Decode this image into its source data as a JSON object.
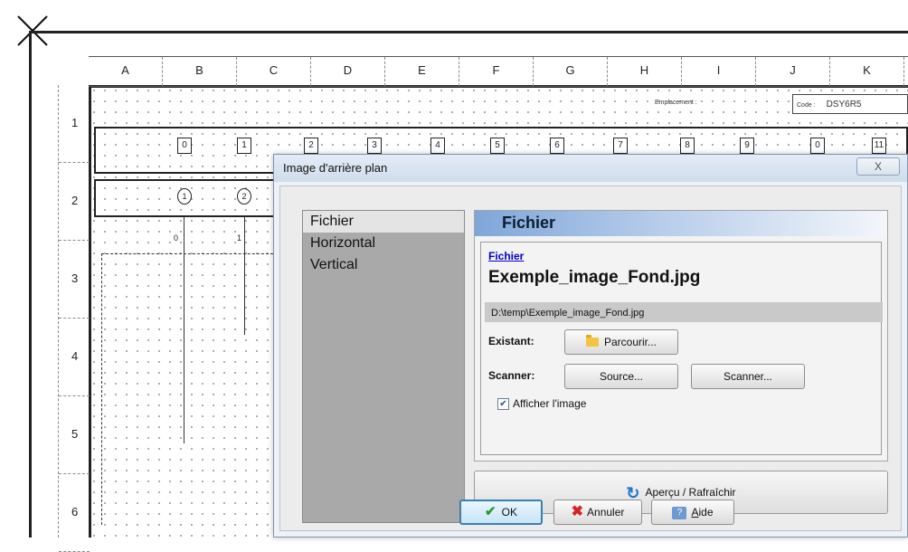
{
  "drawing": {
    "columns": [
      "A",
      "B",
      "C",
      "D",
      "E",
      "F",
      "G",
      "H",
      "I",
      "J",
      "K"
    ],
    "rows": [
      "1",
      "2",
      "3",
      "4",
      "5",
      "6"
    ],
    "header_fields": {
      "emplacement_label": "Emplacement :",
      "code_label": "Code :",
      "code_value": "DSY6R5"
    },
    "terminals_top": [
      "0",
      "1",
      "2",
      "3",
      "4",
      "5",
      "6",
      "7",
      "8",
      "9",
      "0",
      "11"
    ],
    "terminals_circle": [
      "1",
      "2"
    ],
    "wire_labels": [
      "0",
      "1"
    ]
  },
  "dialog": {
    "title": "Image d'arrière plan",
    "close_label": "X",
    "nav_items": [
      "Fichier",
      "Horizontal",
      "Vertical"
    ],
    "selected_nav": "Fichier",
    "panel_title": "Fichier",
    "file_link": "Fichier",
    "file_name": "Exemple_image_Fond.jpg",
    "file_path": "D:\\temp\\Exemple_image_Fond.jpg",
    "existant_label": "Existant:",
    "browse_label": "Parcourir...",
    "scanner_label": "Scanner:",
    "source_label": "Source...",
    "scan_label": "Scanner...",
    "show_image_label": "Afficher l'image",
    "show_image_checked": true,
    "refresh_label": "Aperçu / Rafraîchir",
    "ok_label": "OK",
    "cancel_label": "Annuler",
    "help_label_prefix": "",
    "help_label_underlined": "A",
    "help_label_rest": "ide"
  }
}
